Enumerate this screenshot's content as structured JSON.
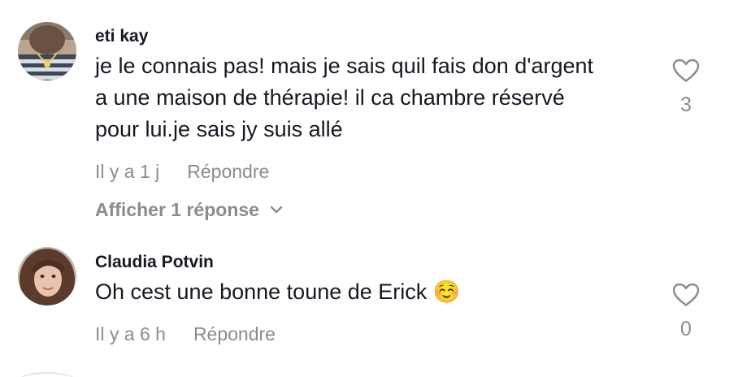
{
  "comments": [
    {
      "username": "eti kay",
      "text": "je le connais pas! mais je sais quil fais don d'argent\na une maison de thérapie! il ca chambre réservé\npour lui.je sais jy suis allé",
      "time": "Il y a 1 j",
      "reply_label": "Répondre",
      "view_replies": "Afficher 1 réponse",
      "likes": "3"
    },
    {
      "username": "Claudia Potvin",
      "text": "Oh cest une bonne toune de Erick ☺️",
      "time": "Il y a 6 h",
      "reply_label": "Répondre",
      "likes": "0"
    }
  ],
  "icons": {
    "like": "heart-outline-icon",
    "expand": "chevron-down-icon"
  },
  "colors": {
    "primary_text": "#161823",
    "secondary_text": "#8a8b91"
  }
}
